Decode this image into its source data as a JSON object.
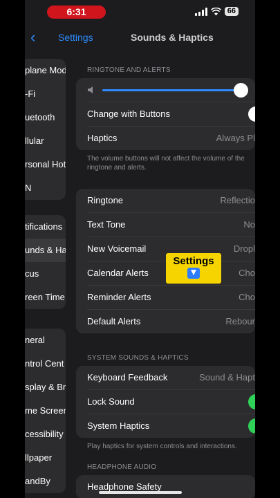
{
  "status_bar": {
    "time": "6:31",
    "battery": "66"
  },
  "nav": {
    "back_label": "Settings",
    "title": "Sounds & Haptics"
  },
  "sidebar": {
    "group1": [
      "plane Mode",
      "-Fi",
      "uetooth",
      "llular",
      "rsonal Hot",
      "N"
    ],
    "group2": [
      "tifications",
      "unds & Ha",
      "cus",
      "reen Time"
    ],
    "group3": [
      "neral",
      "ntrol Cent",
      "splay & Bri",
      "me Screen",
      "cessibility",
      "llpaper",
      "andBy"
    ]
  },
  "ringtone_section": {
    "header": "RINGTONE AND ALERTS",
    "volume_level": 0.95,
    "rows": [
      {
        "label": "Change with Buttons"
      },
      {
        "label": "Haptics",
        "value": "Always Pl"
      }
    ],
    "footnote_line1": "The volume buttons will not affect the volume of the",
    "footnote_line2": "ringtone and alerts."
  },
  "sounds_section": {
    "rows": [
      {
        "label": "Ringtone",
        "value": "Reflectio"
      },
      {
        "label": "Text Tone",
        "value": "No"
      },
      {
        "label": "New Voicemail",
        "value": "Dropl"
      },
      {
        "label": "Calendar Alerts",
        "value": "Cho"
      },
      {
        "label": "Reminder Alerts",
        "value": "Cho"
      },
      {
        "label": "Default Alerts",
        "value": "Rebour"
      }
    ]
  },
  "system_section": {
    "header": "SYSTEM SOUNDS & HAPTICS",
    "rows": [
      {
        "label": "Keyboard Feedback",
        "value": "Sound & Hapt"
      },
      {
        "label": "Lock Sound"
      },
      {
        "label": "System Haptics"
      }
    ],
    "footnote": "Play haptics for system controls and interactions."
  },
  "headphone_section": {
    "header": "HEADPHONE AUDIO",
    "rows": [
      {
        "label": "Headphone Safety"
      }
    ]
  },
  "overlay": {
    "text": "Settings",
    "icon": "down-arrow-emoji-icon"
  },
  "colors": {
    "accent": "#2d8cff",
    "toggle_on": "#30d158",
    "time_pill": "#d0151d",
    "badge": "#f5d400"
  }
}
